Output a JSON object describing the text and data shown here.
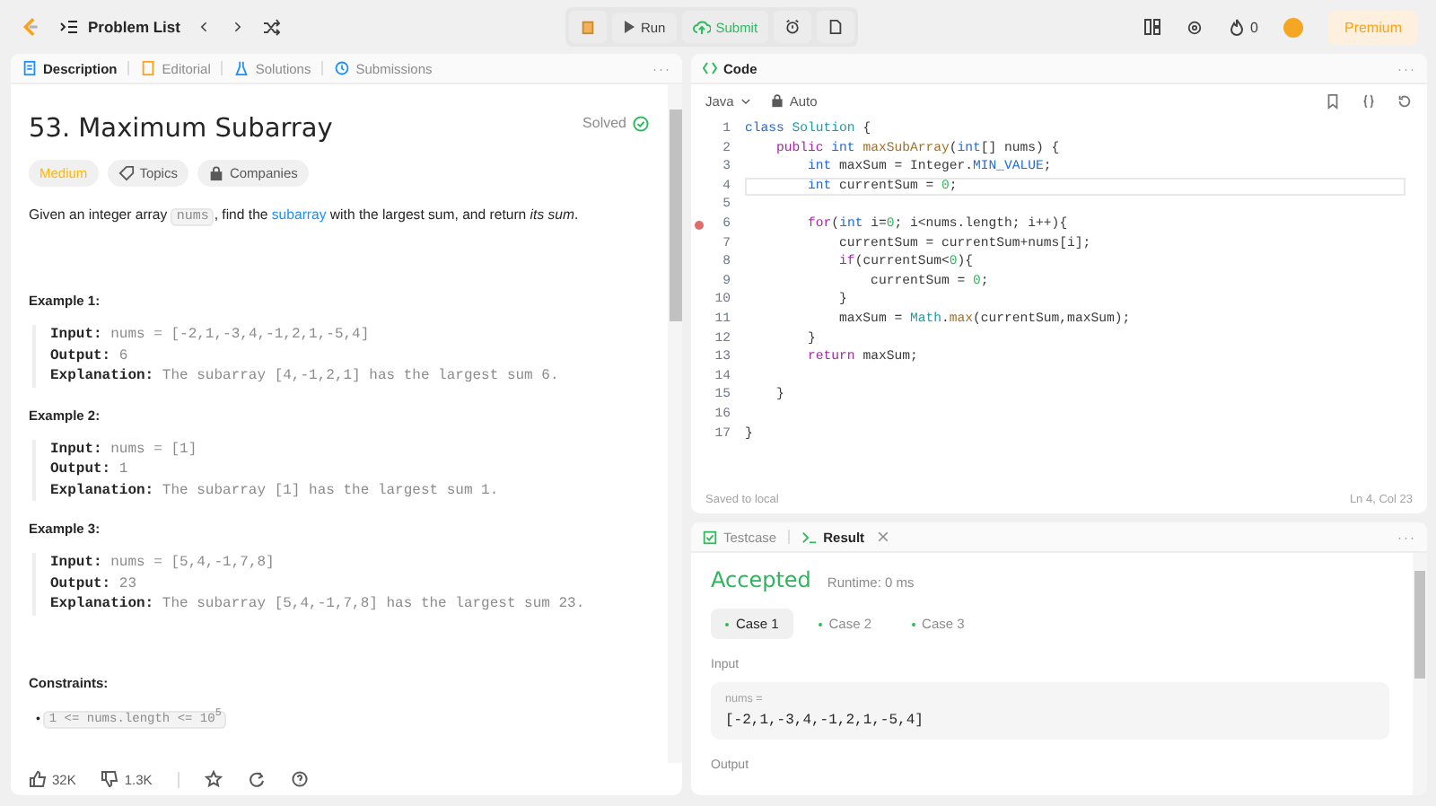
{
  "topbar": {
    "problem_list": "Problem List",
    "run": "Run",
    "submit": "Submit",
    "streak": "0",
    "premium": "Premium"
  },
  "description": {
    "tabs": [
      {
        "label": "Description",
        "selected": true
      },
      {
        "label": "Editorial",
        "selected": false
      },
      {
        "label": "Solutions",
        "selected": false
      },
      {
        "label": "Submissions",
        "selected": false
      }
    ],
    "more": "···",
    "title": "53. Maximum Subarray",
    "status": "Solved",
    "difficulty": "Medium",
    "tags": [
      "Topics",
      "Companies"
    ],
    "statement": [
      {
        "kind": "text",
        "text": "Given an integer array "
      },
      {
        "kind": "code",
        "text": "nums"
      },
      {
        "kind": "text",
        "text": ", find the "
      },
      {
        "kind": "link",
        "text": "subarray"
      },
      {
        "kind": "text",
        "text": " with the largest sum, and return *its sum*."
      }
    ],
    "examples": [
      {
        "title": "Example 1:",
        "lines": [
          {
            "label": "Input:",
            "value": "nums = [-2,1,-3,4,-1,2,1,-5,4]"
          },
          {
            "label": "Output:",
            "value": "6"
          },
          {
            "label": "Explanation:",
            "value": "The subarray [4,-1,2,1] has the largest sum 6."
          }
        ]
      },
      {
        "title": "Example 2:",
        "lines": [
          {
            "label": "Input:",
            "value": "nums = [1]"
          },
          {
            "label": "Output:",
            "value": "1"
          },
          {
            "label": "Explanation:",
            "value": "The subarray [1] has the largest sum 1."
          }
        ]
      },
      {
        "title": "Example 3:",
        "lines": [
          {
            "label": "Input:",
            "value": "nums = [5,4,-1,7,8]"
          },
          {
            "label": "Output:",
            "value": "23"
          },
          {
            "label": "Explanation:",
            "value": "The subarray [5,4,-1,7,8] has the largest sum 23."
          }
        ]
      }
    ],
    "constraints_title": "Constraints:",
    "constraints": [
      {
        "bullet": "•",
        "text": "1 <= nums.length <= 10$^{5}$"
      }
    ],
    "likes": "32K",
    "dislikes": "1.3K"
  },
  "code": {
    "title": "Code",
    "more": "···",
    "language": "Java",
    "mode": "Auto",
    "lines": [
      {
        "n": "1",
        "breakpoint": false,
        "current": false,
        "tokens": [
          {
            "kind": "kw",
            "text": "class"
          },
          {
            "kind": "type",
            "text": " Solution"
          },
          {
            "kind": "plain",
            "text": " {"
          }
        ]
      },
      {
        "n": "2",
        "breakpoint": false,
        "current": false,
        "tokens": [
          {
            "kind": "ctrl",
            "text": "    public"
          },
          {
            "kind": "kw",
            "text": " int"
          },
          {
            "kind": "fn",
            "text": " maxSubArray"
          },
          {
            "kind": "plain",
            "text": "("
          },
          {
            "kind": "kw",
            "text": "int"
          },
          {
            "kind": "plain",
            "text": "[] nums) {"
          }
        ]
      },
      {
        "n": "3",
        "breakpoint": false,
        "current": false,
        "tokens": [
          {
            "kind": "kw",
            "text": "        int"
          },
          {
            "kind": "plain",
            "text": " maxSum = Integer."
          },
          {
            "kind": "kw",
            "text": "MIN_VALUE"
          },
          {
            "kind": "plain",
            "text": ";"
          }
        ]
      },
      {
        "n": "4",
        "breakpoint": false,
        "current": true,
        "tokens": [
          {
            "kind": "kw",
            "text": "        int"
          },
          {
            "kind": "plain",
            "text": " currentSum = "
          },
          {
            "kind": "num",
            "text": "0"
          },
          {
            "kind": "plain",
            "text": ";"
          }
        ]
      },
      {
        "n": "5",
        "breakpoint": false,
        "current": false
      },
      {
        "n": "6",
        "breakpoint": true,
        "current": false,
        "tokens": [
          {
            "kind": "ctrl",
            "text": "        for"
          },
          {
            "kind": "plain",
            "text": "("
          },
          {
            "kind": "kw",
            "text": "int"
          },
          {
            "kind": "plain",
            "text": " i="
          },
          {
            "kind": "num",
            "text": "0"
          },
          {
            "kind": "plain",
            "text": "; i<nums.length; i++){"
          }
        ]
      },
      {
        "n": "7",
        "breakpoint": false,
        "current": false,
        "tokens": [
          {
            "kind": "plain",
            "text": "            currentSum = currentSum+nums[i];"
          }
        ]
      },
      {
        "n": "8",
        "breakpoint": false,
        "current": false,
        "tokens": [
          {
            "kind": "ctrl",
            "text": "            if"
          },
          {
            "kind": "plain",
            "text": "(currentSum<"
          },
          {
            "kind": "num",
            "text": "0"
          },
          {
            "kind": "plain",
            "text": "){"
          }
        ]
      },
      {
        "n": "9",
        "breakpoint": false,
        "current": false,
        "tokens": [
          {
            "kind": "plain",
            "text": "                currentSum = "
          },
          {
            "kind": "num",
            "text": "0"
          },
          {
            "kind": "plain",
            "text": ";"
          }
        ]
      },
      {
        "n": "10",
        "breakpoint": false,
        "current": false,
        "tokens": [
          {
            "kind": "plain",
            "text": "            }"
          }
        ]
      },
      {
        "n": "11",
        "breakpoint": false,
        "current": false,
        "tokens": [
          {
            "kind": "plain",
            "text": "            maxSum = "
          },
          {
            "kind": "type",
            "text": "Math"
          },
          {
            "kind": "plain",
            "text": "."
          },
          {
            "kind": "fn",
            "text": "max"
          },
          {
            "kind": "plain",
            "text": "(currentSum,maxSum);"
          }
        ]
      },
      {
        "n": "12",
        "breakpoint": false,
        "current": false,
        "tokens": [
          {
            "kind": "plain",
            "text": "        }"
          }
        ]
      },
      {
        "n": "13",
        "breakpoint": false,
        "current": false,
        "tokens": [
          {
            "kind": "ctrl",
            "text": "        return"
          },
          {
            "kind": "plain",
            "text": " maxSum;"
          }
        ]
      },
      {
        "n": "14",
        "breakpoint": false,
        "current": false
      },
      {
        "n": "15",
        "breakpoint": false,
        "current": false,
        "tokens": [
          {
            "kind": "plain",
            "text": "    }"
          }
        ]
      },
      {
        "n": "16",
        "breakpoint": false,
        "current": false
      },
      {
        "n": "17",
        "breakpoint": false,
        "current": false,
        "tokens": [
          {
            "kind": "plain",
            "text": "}"
          }
        ]
      }
    ],
    "saved": "Saved to local",
    "cursor": "Ln 4, Col 23"
  },
  "result": {
    "tabs": [
      {
        "label": "Testcase",
        "selected": false
      },
      {
        "label": "Result",
        "selected": true
      }
    ],
    "more": "···",
    "verdict": "Accepted",
    "runtime": "Runtime: 0 ms",
    "cases": [
      {
        "label": "Case 1",
        "selected": true
      },
      {
        "label": "Case 2",
        "selected": false
      },
      {
        "label": "Case 3",
        "selected": false
      }
    ],
    "input_label": "Input",
    "param": "nums =",
    "value": "[-2,1,-3,4,-1,2,1,-5,4]",
    "output_label": "Output"
  }
}
